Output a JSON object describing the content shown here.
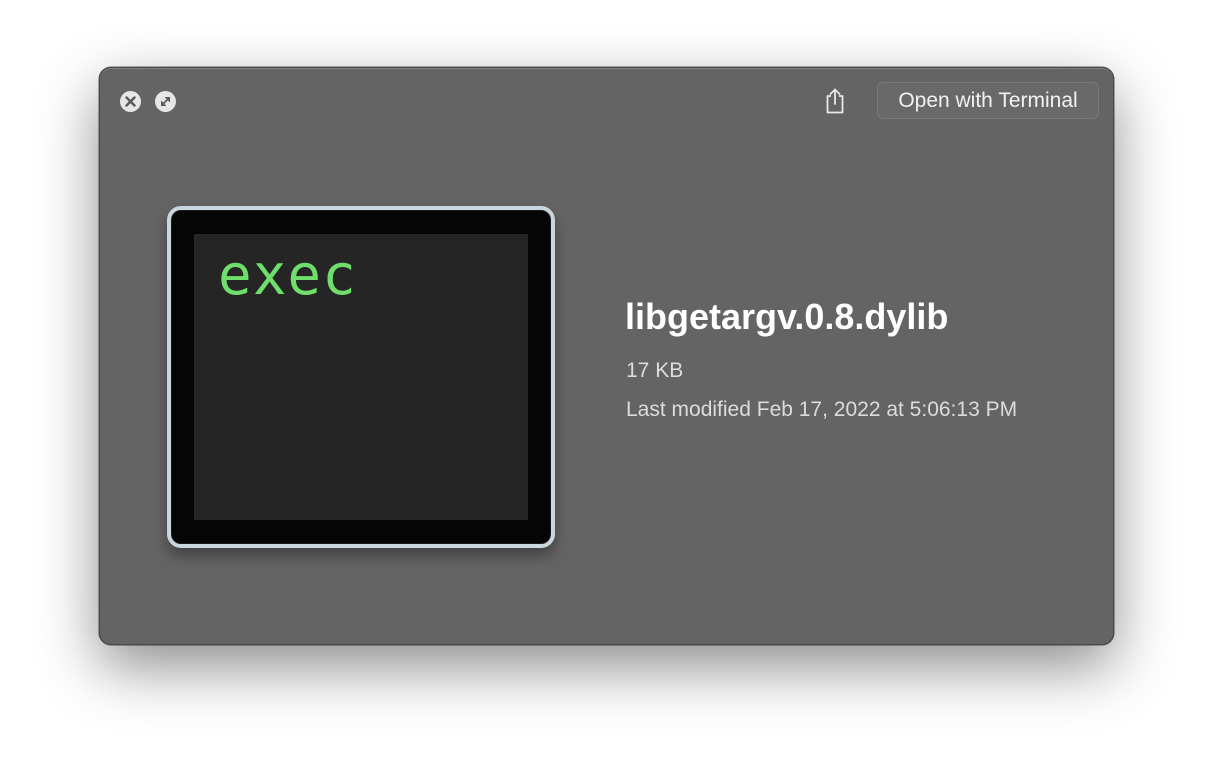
{
  "toolbar": {
    "close_icon": "close-icon",
    "fullscreen_icon": "fullscreen-icon",
    "share_icon": "share-icon",
    "open_button_label": "Open with Terminal"
  },
  "preview": {
    "icon_text": "exec",
    "icon_text_color": "#6fde6a"
  },
  "file": {
    "name": "libgetargv.0.8.dylib",
    "size": "17 KB",
    "modified": "Last modified Feb 17, 2022 at 5:06:13 PM"
  },
  "colors": {
    "window_background": "#656465",
    "text_primary": "#ffffff",
    "text_secondary": "#dcdcdc"
  }
}
